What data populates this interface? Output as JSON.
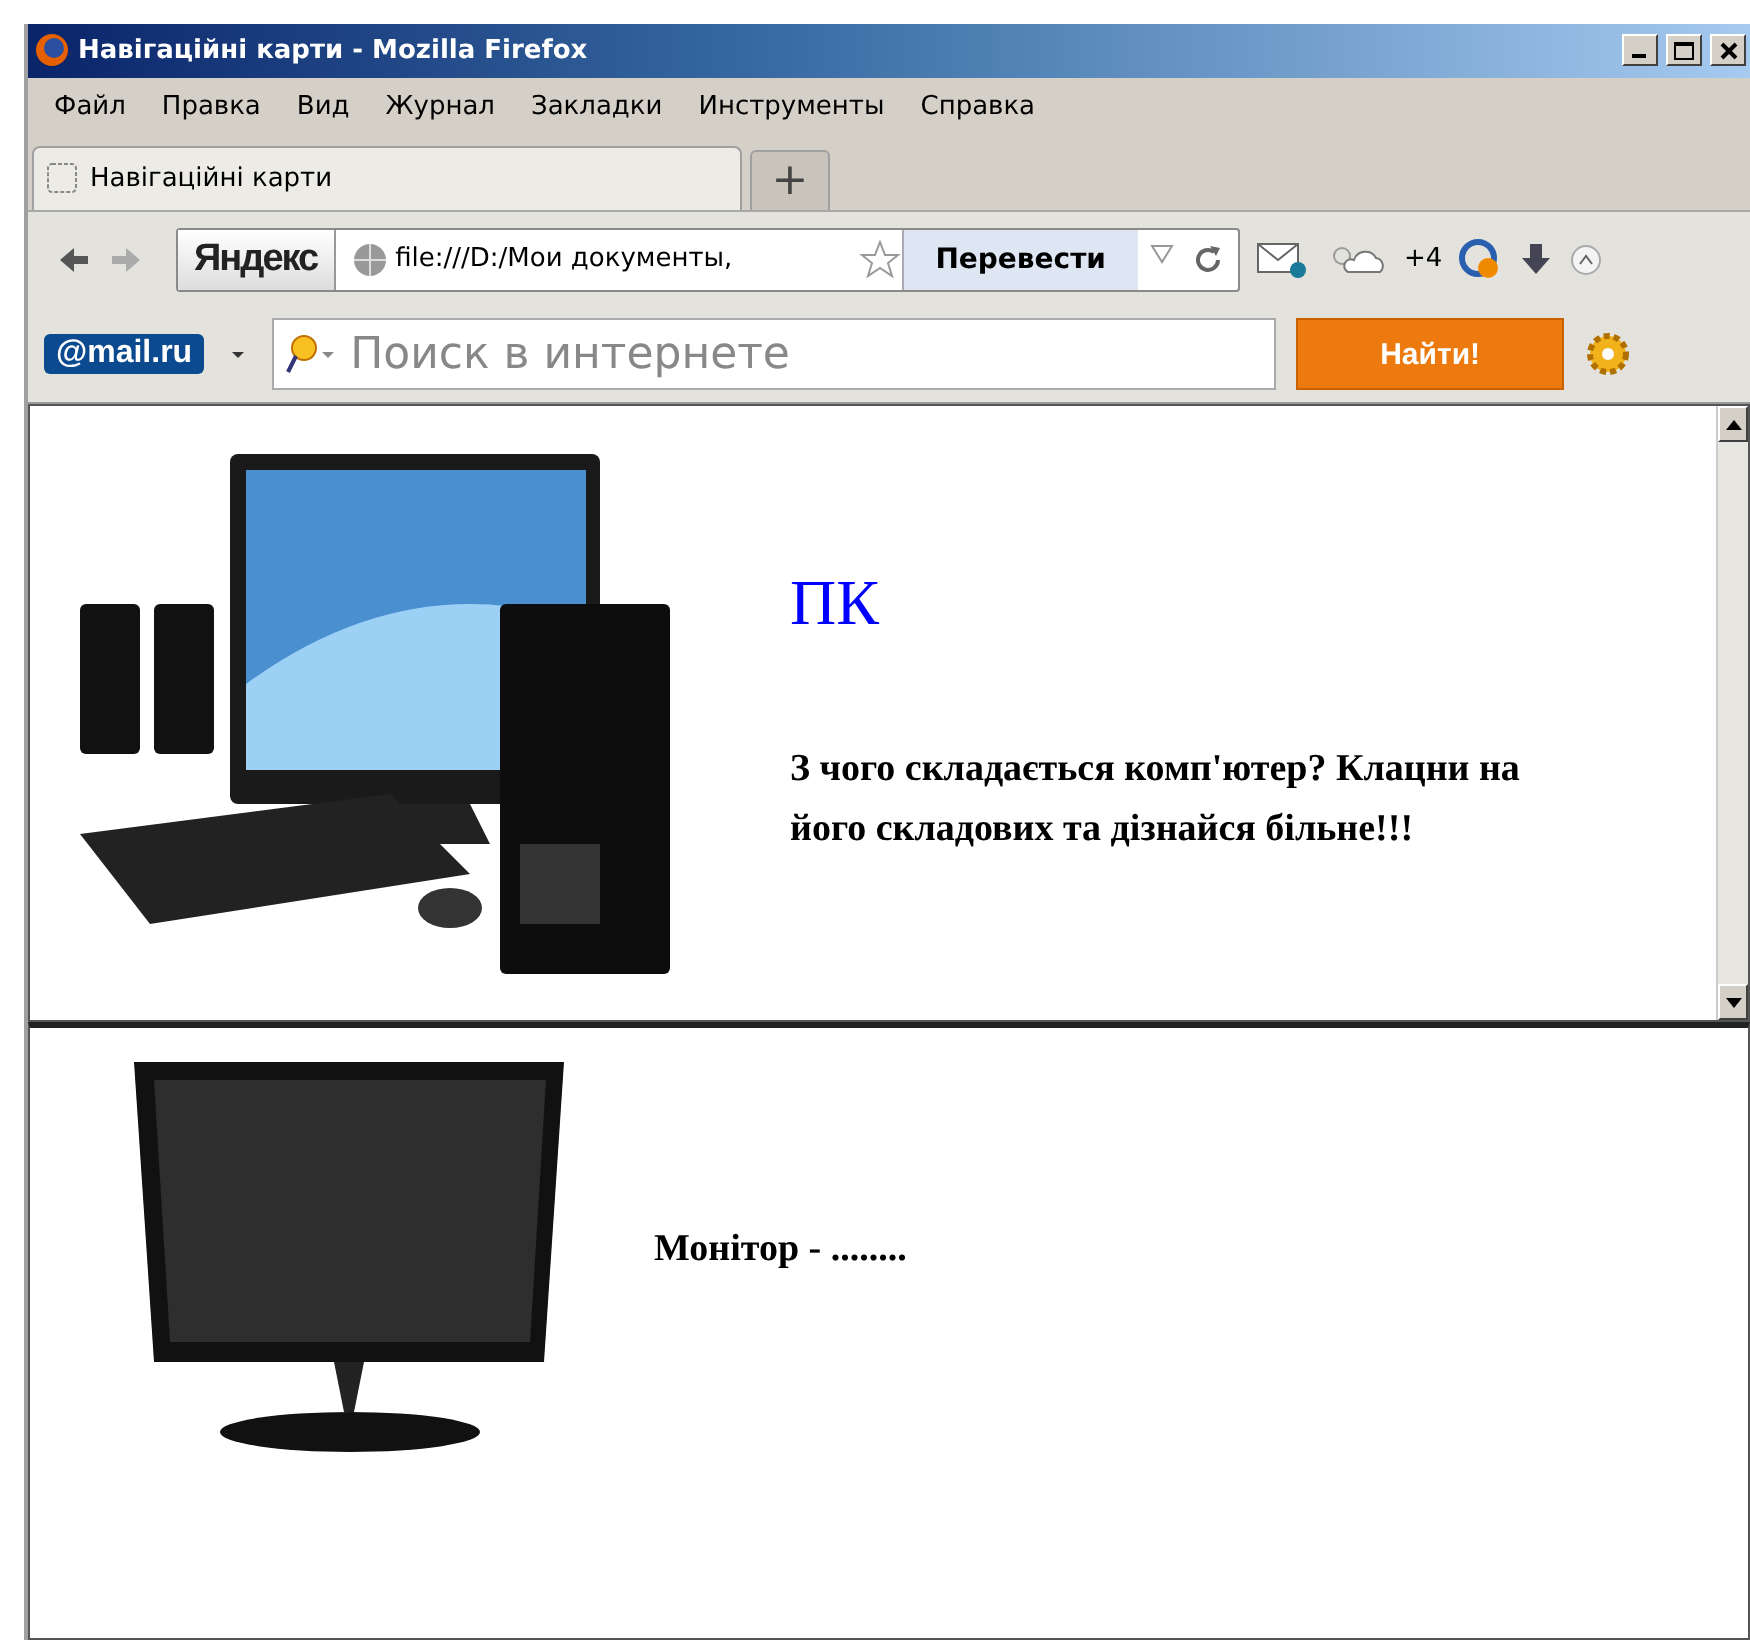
{
  "window": {
    "title": "Навігаційні карти - Mozilla Firefox"
  },
  "menu": [
    {
      "label": "Файл"
    },
    {
      "label": "Правка"
    },
    {
      "label": "Вид"
    },
    {
      "label": "Журнал"
    },
    {
      "label": "Закладки"
    },
    {
      "label": "Инструменты"
    },
    {
      "label": "Справка"
    }
  ],
  "tabs": [
    {
      "label": "Навігаційні карти",
      "selected": true
    }
  ],
  "new_tab": "+",
  "navbar": {
    "search_engine": "Яндекс",
    "url": "file:///D:/Мои документы,",
    "translate_button": "Перевести",
    "weather": "+4"
  },
  "mail_toolbar": {
    "logo": "@mail.ru",
    "search_placeholder": "Поиск в интернете",
    "search_button": "Найти!"
  },
  "top_frame": {
    "heading": "ПК",
    "text": "З чого складається комп'ютер? Клацни на його складових та дізнайся більне!!!"
  },
  "bottom_frame": {
    "text": "Монітор - ........"
  }
}
